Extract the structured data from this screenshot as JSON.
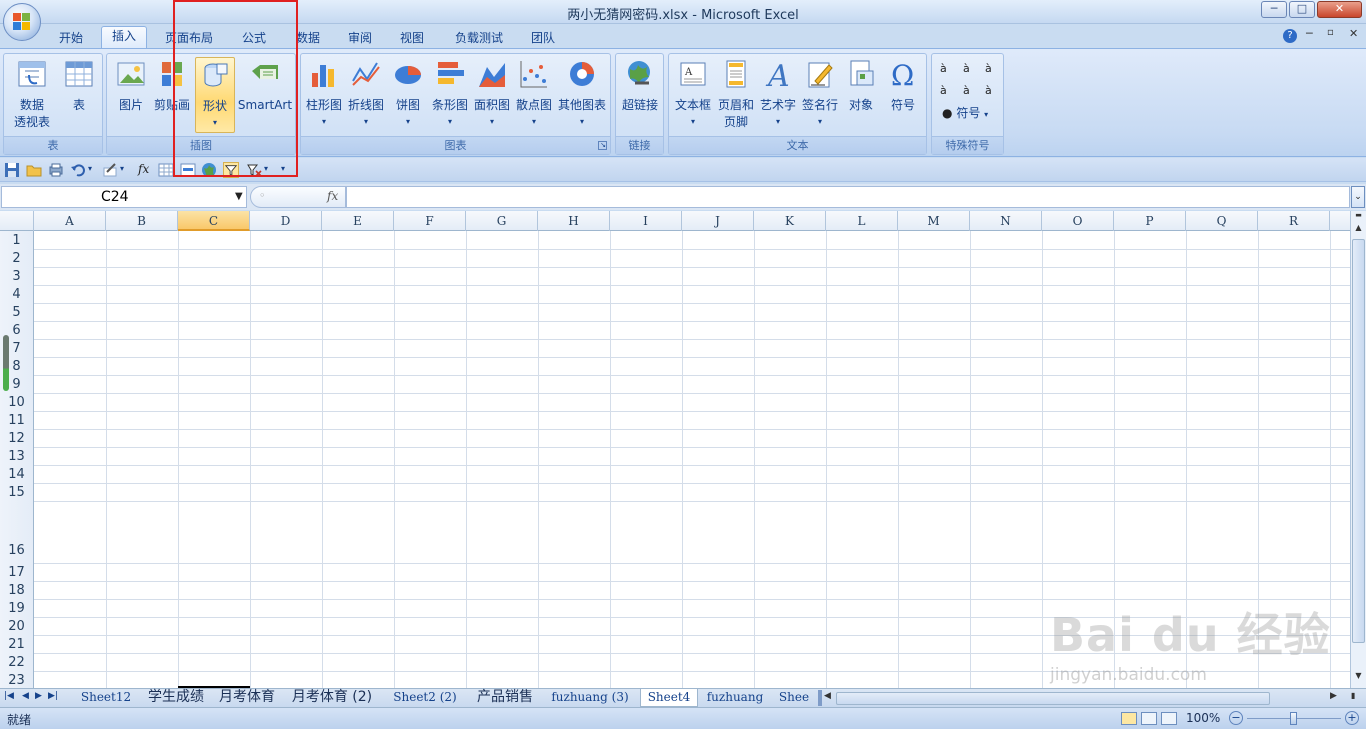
{
  "window": {
    "title": "两小无猜网密码.xlsx - Microsoft Excel",
    "controls": [
      "─",
      "□",
      "✕"
    ]
  },
  "tabs": [
    "开始",
    "插入",
    "页面布局",
    "公式",
    "数据",
    "审阅",
    "视图",
    "负载测试",
    "团队"
  ],
  "ribbon": {
    "groups": {
      "tables": {
        "label": "表",
        "buttons": [
          "数据\n透视表",
          "表"
        ]
      },
      "illustrations": {
        "label": "插图",
        "buttons": [
          "图片",
          "剪贴画",
          "形状",
          "SmartArt"
        ]
      },
      "charts": {
        "label": "图表",
        "buttons": [
          "柱形图",
          "折线图",
          "饼图",
          "条形图",
          "面积图",
          "散点图",
          "其他图表"
        ]
      },
      "links": {
        "label": "链接",
        "buttons": [
          "超链接"
        ]
      },
      "text": {
        "label": "文本",
        "buttons": [
          "文本框",
          "页眉和\n页脚",
          "艺术字",
          "签名行",
          "对象",
          "符号"
        ]
      },
      "special": {
        "label": "特殊符号",
        "symbols": [
          "à",
          "à",
          "à",
          "à",
          "à",
          "à"
        ],
        "button": "符号"
      }
    }
  },
  "formula_bar": {
    "name_box": "C24",
    "fx": "fx",
    "formula": ""
  },
  "columns": [
    "A",
    "B",
    "C",
    "D",
    "E",
    "F",
    "G",
    "H",
    "I",
    "J",
    "K",
    "L",
    "M",
    "N",
    "O",
    "P",
    "Q",
    "R"
  ],
  "selected_column": "C",
  "rows": [
    "1",
    "2",
    "3",
    "4",
    "5",
    "6",
    "7",
    "8",
    "9",
    "10",
    "11",
    "12",
    "13",
    "14",
    "15",
    "16",
    "17",
    "18",
    "19",
    "20",
    "21",
    "22",
    "23"
  ],
  "sheets": [
    "Sheet12",
    "学生成绩",
    "月考体育",
    "月考体育 (2)",
    "Sheet2 (2)",
    "产品销售",
    "fuzhuang (3)",
    "Sheet4",
    "fuzhuang",
    "Shee"
  ],
  "active_sheet": "Sheet4",
  "status": {
    "ready": "就绪",
    "zoom": "100%"
  },
  "watermark": {
    "brand": "Bai du 经验",
    "url": "jingyan.baidu.com"
  }
}
